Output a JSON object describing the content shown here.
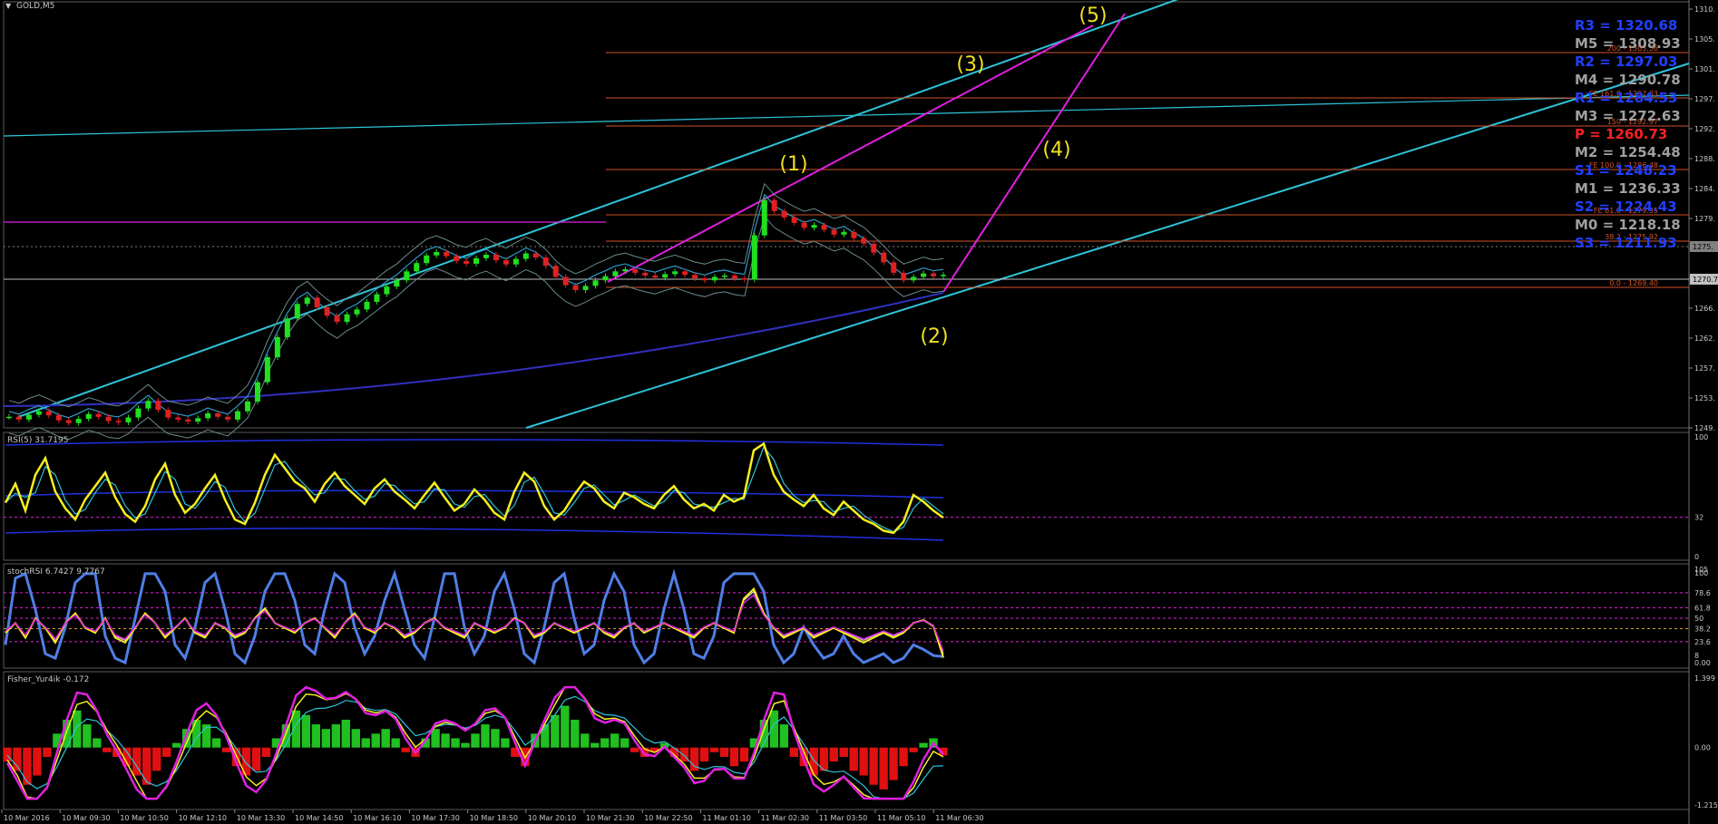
{
  "symbol_title": "GOLD,M5",
  "colors": {
    "background": "#000000",
    "channel": "#2ec4d8",
    "magenta": "#e020e0",
    "level_line": "#d2522a",
    "wave_label": "#f0e020",
    "rsi": "#f5ef1e",
    "stoch_blue": "#4f7fe6",
    "fisher_up": "#20c020",
    "fisher_down": "#e01010",
    "pivot_blue": "#2040ff",
    "pivot_gray": "#a0a0a0",
    "pivot_red": "#ff2020"
  },
  "chart_data": [
    {
      "type": "line",
      "panel": "price",
      "symbol": "GOLD",
      "timeframe": "M5",
      "y_ticks": [
        "1310.",
        "1305.",
        "1301.",
        "1297.",
        "1292.",
        "1288.",
        "1284.",
        "1279.",
        "1275.",
        "1270.",
        "1266.",
        "1262.",
        "1257.",
        "1253.",
        "1249."
      ],
      "ylim": [
        1249,
        1310
      ],
      "x_ticks": [
        "10 Mar 2016",
        "10 Mar 09:30",
        "10 Mar 10:50",
        "10 Mar 12:10",
        "10 Mar 13:30",
        "10 Mar 14:50",
        "10 Mar 16:10",
        "10 Mar 17:30",
        "10 Mar 18:50",
        "10 Mar 20:10",
        "10 Mar 21:30",
        "10 Mar 22:50",
        "11 Mar 01:10",
        "11 Mar 02:30",
        "11 Mar 03:50",
        "11 Mar 05:10",
        "11 Mar 06:30"
      ],
      "close": [
        1250.6,
        1250.2,
        1250.9,
        1251.4,
        1250.8,
        1250.1,
        1249.7,
        1250.3,
        1251.0,
        1250.6,
        1250.0,
        1249.8,
        1250.5,
        1251.8,
        1252.9,
        1251.6,
        1250.5,
        1250.2,
        1249.9,
        1250.4,
        1251.1,
        1250.6,
        1250.2,
        1251.4,
        1252.8,
        1255.6,
        1259.2,
        1262.1,
        1264.8,
        1266.9,
        1267.8,
        1266.4,
        1265.2,
        1264.3,
        1265.4,
        1266.1,
        1267.2,
        1268.3,
        1269.4,
        1270.3,
        1271.6,
        1272.8,
        1273.9,
        1274.4,
        1273.8,
        1273.1,
        1272.7,
        1273.5,
        1274.0,
        1273.2,
        1272.6,
        1273.4,
        1274.2,
        1273.6,
        1272.4,
        1270.8,
        1269.6,
        1268.9,
        1269.5,
        1270.3,
        1270.9,
        1271.6,
        1271.9,
        1271.4,
        1271.0,
        1270.7,
        1271.2,
        1271.6,
        1271.1,
        1270.6,
        1270.3,
        1270.8,
        1271.0,
        1270.6,
        1270.4,
        1276.8,
        1281.9,
        1280.3,
        1279.4,
        1278.6,
        1277.9,
        1278.3,
        1277.6,
        1276.9,
        1277.3,
        1276.4,
        1275.6,
        1274.3,
        1272.9,
        1271.4,
        1270.3,
        1270.8,
        1271.3,
        1270.9,
        1271.1
      ],
      "wave_labels": [
        "(1)",
        "(2)",
        "(3)",
        "(4)",
        "(5)"
      ],
      "levels": [
        {
          "label": "200 - 1303.56",
          "value": 1303.56
        },
        {
          "label": "FE 161.8 - 1297.03",
          "value": 1297.03
        },
        {
          "label": "150 - 1292.97",
          "value": 1292.97
        },
        {
          "label": "FE 100.0 - 1286.48",
          "value": 1286.48
        },
        {
          "label": "FE 61.8 - 1279.95",
          "value": 1279.95
        },
        {
          "label": "38.2 - 1275.92",
          "value": 1275.92
        },
        {
          "label": "0.0 - 1269.40",
          "value": 1269.4
        }
      ],
      "price_markers": [
        "1275.",
        "1270.7"
      ],
      "pivots": [
        {
          "label": "R3 = 1320.68",
          "kind": "blue"
        },
        {
          "label": "M5 = 1308.93",
          "kind": "gray"
        },
        {
          "label": "R2 = 1297.03",
          "kind": "blue"
        },
        {
          "label": "M4 = 1290.78",
          "kind": "gray"
        },
        {
          "label": "R1 = 1284.53",
          "kind": "blue"
        },
        {
          "label": "M3 = 1272.63",
          "kind": "gray"
        },
        {
          "label": "P  = 1260.73",
          "kind": "red"
        },
        {
          "label": "M2 = 1254.48",
          "kind": "gray"
        },
        {
          "label": "S1 = 1248.23",
          "kind": "blue"
        },
        {
          "label": "M1 = 1236.33",
          "kind": "gray"
        },
        {
          "label": "S2 = 1224.43",
          "kind": "blue"
        },
        {
          "label": "M0 = 1218.18",
          "kind": "gray"
        },
        {
          "label": "S3 = 1211.93",
          "kind": "blue"
        }
      ]
    },
    {
      "type": "line",
      "panel": "rsi",
      "title": "RSI(5) 31.7195",
      "ylim": [
        0,
        100
      ],
      "y_ticks": [
        "100",
        "32",
        "0"
      ],
      "level": 32,
      "values": [
        45,
        62,
        38,
        70,
        85,
        55,
        40,
        30,
        48,
        60,
        72,
        50,
        35,
        28,
        42,
        66,
        80,
        52,
        36,
        44,
        58,
        70,
        48,
        30,
        26,
        45,
        70,
        88,
        76,
        64,
        58,
        46,
        62,
        72,
        60,
        52,
        44,
        58,
        66,
        55,
        48,
        40,
        52,
        63,
        50,
        38,
        44,
        57,
        48,
        36,
        30,
        55,
        72,
        64,
        42,
        30,
        38,
        52,
        64,
        58,
        46,
        40,
        54,
        50,
        44,
        40,
        52,
        60,
        48,
        40,
        44,
        38,
        52,
        46,
        50,
        92,
        98,
        70,
        55,
        48,
        42,
        52,
        40,
        34,
        46,
        38,
        30,
        26,
        20,
        18,
        28,
        52,
        46,
        38,
        31.7
      ]
    },
    {
      "type": "line",
      "panel": "stochrsi",
      "title": "stochRSI 6.7427 9.7767",
      "ylim": [
        0,
        105
      ],
      "y_ticks": [
        "105",
        "100",
        "78.6",
        "61.8",
        "50",
        "38.2",
        "23.6",
        "8",
        "0.00"
      ],
      "series": [
        {
          "values": [
            20,
            95,
            100,
            60,
            10,
            5,
            40,
            90,
            100,
            100,
            30,
            5,
            0,
            50,
            100,
            100,
            80,
            20,
            5,
            40,
            90,
            100,
            60,
            10,
            0,
            30,
            80,
            100,
            100,
            70,
            20,
            10,
            60,
            100,
            90,
            40,
            10,
            30,
            70,
            100,
            60,
            20,
            5,
            50,
            100,
            100,
            40,
            10,
            30,
            80,
            100,
            60,
            10,
            0,
            40,
            90,
            100,
            50,
            10,
            20,
            70,
            100,
            80,
            20,
            0,
            10,
            60,
            100,
            60,
            10,
            5,
            30,
            90,
            100,
            100,
            100,
            80,
            20,
            0,
            10,
            40,
            20,
            5,
            10,
            30,
            10,
            0,
            5,
            10,
            0,
            5,
            20,
            15,
            8,
            6.7
          ]
        },
        {
          "values": [
            35,
            45,
            30,
            50,
            40,
            25,
            45,
            55,
            40,
            35,
            50,
            30,
            25,
            40,
            55,
            45,
            30,
            40,
            50,
            35,
            30,
            45,
            40,
            30,
            35,
            50,
            60,
            45,
            40,
            35,
            45,
            50,
            40,
            30,
            45,
            55,
            40,
            35,
            45,
            40,
            30,
            35,
            45,
            50,
            40,
            35,
            30,
            45,
            40,
            35,
            40,
            50,
            45,
            30,
            35,
            45,
            40,
            35,
            40,
            45,
            35,
            30,
            40,
            45,
            35,
            40,
            45,
            40,
            35,
            30,
            40,
            45,
            40,
            35,
            70,
            80,
            55,
            40,
            30,
            35,
            40,
            30,
            35,
            40,
            35,
            30,
            25,
            30,
            35,
            30,
            35,
            45,
            48,
            42,
            9.8
          ]
        }
      ]
    },
    {
      "type": "bar",
      "panel": "fisher",
      "title": "Fisher_Yur4ik -0.172",
      "ylim": [
        -1.215,
        1.399
      ],
      "y_ticks": [
        "1.399",
        "0.00",
        "-1.215"
      ],
      "values": [
        -0.3,
        -0.5,
        -0.8,
        -0.6,
        -0.2,
        0.3,
        0.6,
        0.8,
        0.5,
        0.2,
        -0.1,
        -0.2,
        -0.4,
        -0.6,
        -0.8,
        -0.5,
        -0.2,
        0.1,
        0.4,
        0.6,
        0.5,
        0.2,
        -0.1,
        -0.4,
        -0.6,
        -0.5,
        -0.2,
        0.2,
        0.5,
        0.8,
        0.7,
        0.5,
        0.4,
        0.5,
        0.6,
        0.4,
        0.2,
        0.3,
        0.4,
        0.2,
        -0.1,
        -0.2,
        0.2,
        0.4,
        0.3,
        0.2,
        0.1,
        0.3,
        0.5,
        0.4,
        0.2,
        -0.2,
        -0.4,
        0.3,
        0.5,
        0.7,
        0.9,
        0.6,
        0.3,
        0.1,
        0.2,
        0.3,
        0.2,
        -0.1,
        -0.2,
        -0.1,
        0.1,
        -0.2,
        -0.3,
        -0.5,
        -0.3,
        -0.1,
        -0.2,
        -0.4,
        -0.3,
        0.2,
        0.6,
        0.8,
        0.5,
        -0.2,
        -0.4,
        -0.6,
        -0.5,
        -0.3,
        -0.2,
        -0.5,
        -0.6,
        -0.8,
        -0.9,
        -0.7,
        -0.4,
        -0.1,
        0.1,
        0.2,
        -0.172
      ]
    }
  ]
}
